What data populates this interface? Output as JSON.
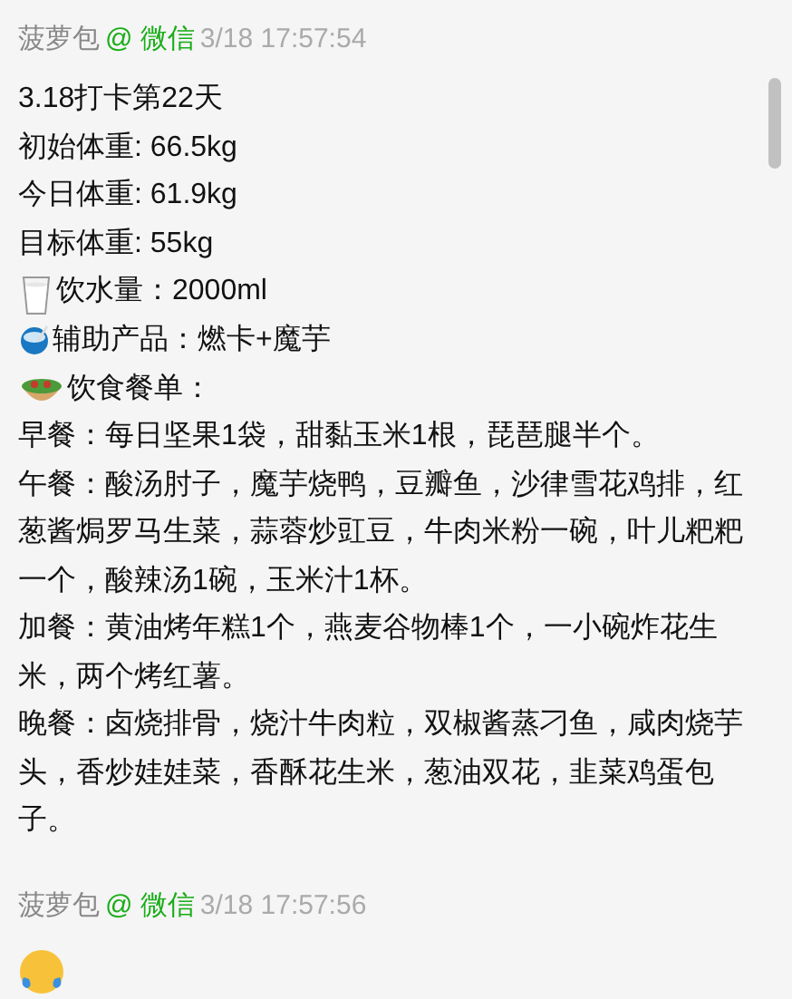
{
  "messages": [
    {
      "sender": "菠萝包",
      "source": "@ 微信",
      "time": "3/18 17:57:54",
      "lines": [
        {
          "kind": "text",
          "text": "3.18打卡第22天"
        },
        {
          "kind": "text",
          "text": "初始体重: 66.5kg"
        },
        {
          "kind": "text",
          "text": "今日体重: 61.9kg"
        },
        {
          "kind": "text",
          "text": "目标体重: 55kg"
        },
        {
          "kind": "glass",
          "text": "饮水量：2000ml"
        },
        {
          "kind": "bowl",
          "text": "辅助产品：燃卡+魔芋"
        },
        {
          "kind": "salad",
          "text": "饮食餐单："
        },
        {
          "kind": "text",
          "text": "早餐：每日坚果1袋，甜黏玉米1根，琵琶腿半个。"
        },
        {
          "kind": "text",
          "text": "午餐：酸汤肘子，魔芋烧鸭，豆瓣鱼，沙律雪花鸡排，红葱酱焗罗马生菜，蒜蓉炒豇豆，牛肉米粉一碗，叶儿粑粑一个，酸辣汤1碗，玉米汁1杯。"
        },
        {
          "kind": "text",
          "text": "加餐：黄油烤年糕1个，燕麦谷物棒1个，一小碗炸花生米，两个烤红薯。"
        },
        {
          "kind": "text",
          "text": "晚餐：卤烧排骨，烧汁牛肉粒，双椒酱蒸刁鱼，咸肉烧芋头，香炒娃娃菜，香酥花生米，葱油双花，韭菜鸡蛋包子。"
        }
      ]
    },
    {
      "sender": "菠萝包",
      "source": "@ 微信",
      "time": "3/18 17:57:56",
      "lines": [
        {
          "kind": "emoji"
        }
      ]
    }
  ]
}
